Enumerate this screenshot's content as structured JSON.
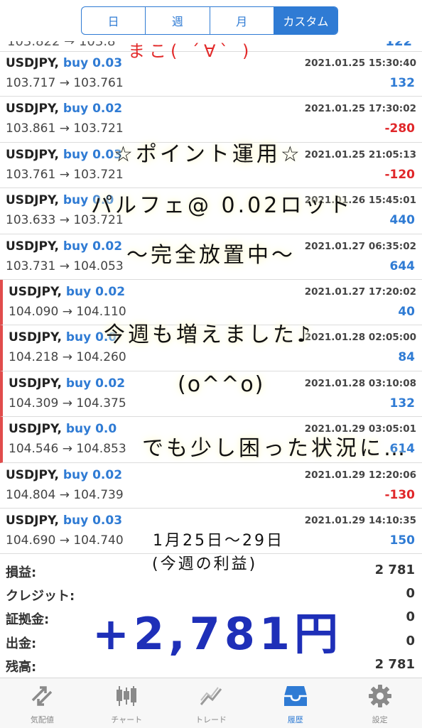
{
  "segments": [
    {
      "label": "日"
    },
    {
      "label": "週"
    },
    {
      "label": "月"
    },
    {
      "label": "カスタム"
    }
  ],
  "partial_row": {
    "prices": "103.822 → 103.8",
    "profit": "122"
  },
  "trades": [
    {
      "symbol": "USDJPY,",
      "side": "buy 0.03",
      "time": "2021.01.25 15:30:40",
      "prices": "103.717 → 103.761",
      "profit": "132",
      "sign": "pos",
      "marked": false
    },
    {
      "symbol": "USDJPY,",
      "side": "buy 0.02",
      "time": "2021.01.25 17:30:02",
      "prices": "103.861 → 103.721",
      "profit": "-280",
      "sign": "neg",
      "marked": false
    },
    {
      "symbol": "USDJPY,",
      "side": "buy 0.03",
      "time": "2021.01.25 21:05:13",
      "prices": "103.761 → 103.721",
      "profit": "-120",
      "sign": "neg",
      "marked": false
    },
    {
      "symbol": "USDJPY,",
      "side": "buy 0.0",
      "time": "2021.01.26 15:45:01",
      "prices": "103.633 → 103.721",
      "profit": "440",
      "sign": "pos",
      "marked": false
    },
    {
      "symbol": "USDJPY,",
      "side": "buy 0.02",
      "time": "2021.01.27 06:35:02",
      "prices": "103.731 → 104.053",
      "profit": "644",
      "sign": "pos",
      "marked": false
    },
    {
      "symbol": "USDJPY,",
      "side": "buy 0.02",
      "time": "2021.01.27 17:20:02",
      "prices": "104.090 → 104.110",
      "profit": "40",
      "sign": "pos",
      "marked": true
    },
    {
      "symbol": "USDJPY,",
      "side": "buy 0.0",
      "time": "2021.01.28 02:05:00",
      "prices": "104.218 → 104.260",
      "profit": "84",
      "sign": "pos",
      "marked": true
    },
    {
      "symbol": "USDJPY,",
      "side": "buy 0.02",
      "time": "2021.01.28 03:10:08",
      "prices": "104.309 → 104.375",
      "profit": "132",
      "sign": "pos",
      "marked": true
    },
    {
      "symbol": "USDJPY,",
      "side": "buy 0.0",
      "time": "2021.01.29 03:05:01",
      "prices": "104.546 → 104.853",
      "profit": "614",
      "sign": "pos",
      "marked": true
    },
    {
      "symbol": "USDJPY,",
      "side": "buy 0.02",
      "time": "2021.01.29 12:20:06",
      "prices": "104.804 → 104.739",
      "profit": "-130",
      "sign": "neg",
      "marked": false
    },
    {
      "symbol": "USDJPY,",
      "side": "buy 0.03",
      "time": "2021.01.29 14:10:35",
      "prices": "104.690 → 104.740",
      "profit": "150",
      "sign": "pos",
      "marked": false
    }
  ],
  "summary": [
    {
      "key": "損益:",
      "value": "2 781"
    },
    {
      "key": "クレジット:",
      "value": "0"
    },
    {
      "key": "証拠金:",
      "value": "0"
    },
    {
      "key": "出金:",
      "value": "0"
    },
    {
      "key": "残高:",
      "value": "2 781"
    }
  ],
  "tabs": [
    {
      "label": "気配値",
      "icon": "quotes-icon",
      "active": false
    },
    {
      "label": "チャート",
      "icon": "chart-icon",
      "active": false
    },
    {
      "label": "トレード",
      "icon": "trade-icon",
      "active": false
    },
    {
      "label": "履歴",
      "icon": "history-icon",
      "active": true
    },
    {
      "label": "設定",
      "icon": "gear-icon",
      "active": false
    }
  ],
  "handwriting": {
    "red": "まこ( ´∀` )",
    "line1": "☆ポイント運用☆",
    "line2": "パルフェ@ 0.02ロット",
    "line3": "〜完全放置中〜",
    "line4": "今週も増えました♪",
    "line5": "(o^^o)",
    "line6": "でも少し困った状況に…",
    "date_range": "1月25日〜29日",
    "note": "(今週の利益)",
    "total": "+2,781円"
  },
  "colors": {
    "accent": "#2f7bd4",
    "negative": "#e0272a",
    "marker": "#e14c4c"
  }
}
